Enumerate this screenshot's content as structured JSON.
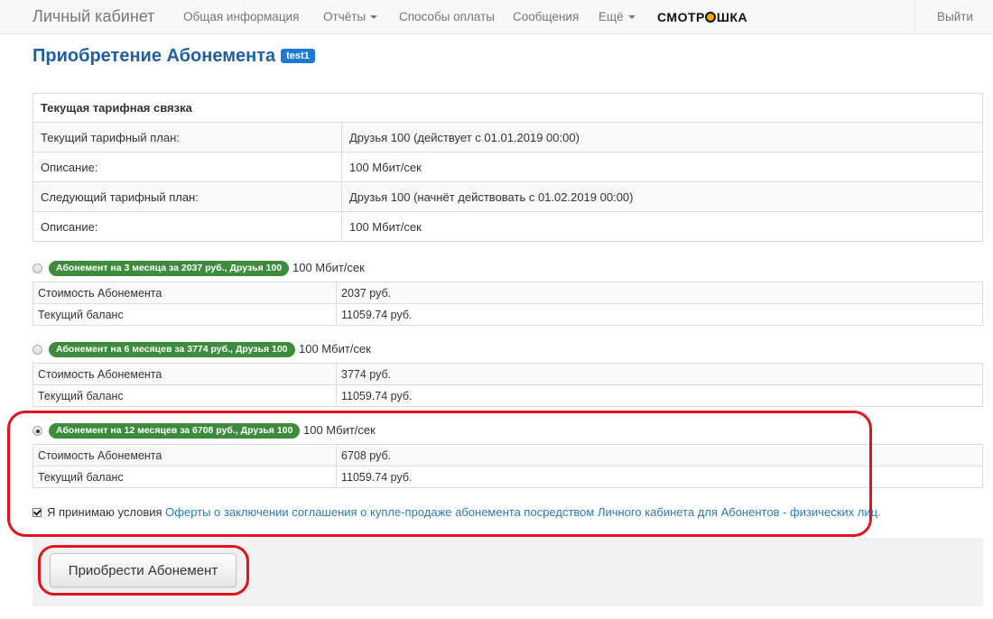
{
  "nav": {
    "brand": "Личный кабинет",
    "items": [
      {
        "label": "Общая информация",
        "dropdown": false
      },
      {
        "label": "Отчёты",
        "dropdown": true
      },
      {
        "label": "Способы оплаты",
        "dropdown": false
      },
      {
        "label": "Сообщения",
        "dropdown": false
      },
      {
        "label": "Ещё",
        "dropdown": true
      }
    ],
    "logo": {
      "before": "СМОТР",
      "after": "ШКА"
    },
    "logout": "Выйти"
  },
  "page": {
    "title": "Приобретение Абонемента",
    "badge": "test1"
  },
  "tariff": {
    "header": "Текущая тарифная связка",
    "rows": [
      {
        "label": "Текущий тарифный план:",
        "value": "Друзья 100 (действует с 01.01.2019 00:00)"
      },
      {
        "label": "Описание:",
        "value": "100 Мбит/сек"
      },
      {
        "label": "Следующий тарифный план:",
        "value": "Друзья 100 (начнёт действовать с 01.02.2019 00:00)"
      },
      {
        "label": "Описание:",
        "value": "100 Мбит/сек"
      }
    ]
  },
  "options": [
    {
      "badge": "Абонемент на 3 месяца за 2037 руб., Друзья 100",
      "speed": "100 Мбит/сек",
      "checked": false,
      "cost_label": "Стоимость Абонемента",
      "cost_value": "2037 руб.",
      "balance_label": "Текущий баланс",
      "balance_value": "11059.74 руб."
    },
    {
      "badge": "Абонемент на 6 месяцев за 3774 руб., Друзья 100",
      "speed": "100 Мбит/сек",
      "checked": false,
      "cost_label": "Стоимость Абонемента",
      "cost_value": "3774 руб.",
      "balance_label": "Текущий баланс",
      "balance_value": "11059.74 руб."
    },
    {
      "badge": "Абонемент на 12 месяцев за 6708 руб., Друзья 100",
      "speed": "100 Мбит/сек",
      "checked": true,
      "cost_label": "Стоимость Абонемента",
      "cost_value": "6708 руб.",
      "balance_label": "Текущий баланс",
      "balance_value": "11059.74 руб."
    }
  ],
  "agreement": {
    "checked": true,
    "text": "Я принимаю условия",
    "link": "Оферты о заключении соглашения о купле-продаже абонемента посредством Личного кабинета для Абонентов - физических лиц."
  },
  "form": {
    "submit_label": "Приобрести Абонемент"
  },
  "colors": {
    "title": "#1f5fa8",
    "title_badge": "#1e7ad6",
    "option_badge": "#3d8b3d",
    "link": "#2a7ab8",
    "highlight": "#e0141e"
  }
}
